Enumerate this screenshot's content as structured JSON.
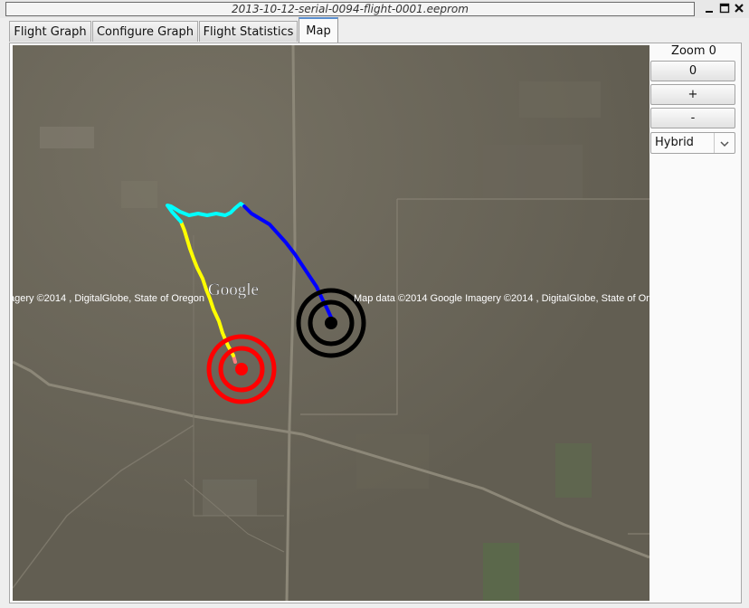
{
  "window": {
    "title": "2013-10-12-serial-0094-flight-0001.eeprom",
    "controls": [
      "minimize-icon",
      "maximize-icon",
      "close-icon"
    ]
  },
  "tabs": [
    {
      "label": "Flight Graph",
      "active": false
    },
    {
      "label": "Configure Graph",
      "active": false
    },
    {
      "label": "Flight Statistics",
      "active": false
    },
    {
      "label": "Map",
      "active": true
    }
  ],
  "map": {
    "google_logo": "Google",
    "copyright_left": "agery ©2014 , DigitalGlobe, State of Oregon",
    "copyright_right": "Map data ©2014 Google  Imagery ©2014 , DigitalGlobe, State of Oreg",
    "markers": [
      "launch-target-icon",
      "landing-target-icon"
    ],
    "track_colors": [
      "#ff0000",
      "#ffff00",
      "#00ffff",
      "#0000ff"
    ]
  },
  "sidebar": {
    "zoom_label": "Zoom 0",
    "zoom_reset_label": "0",
    "zoom_in_label": "+",
    "zoom_out_label": "-",
    "maptype_value": "Hybrid"
  }
}
